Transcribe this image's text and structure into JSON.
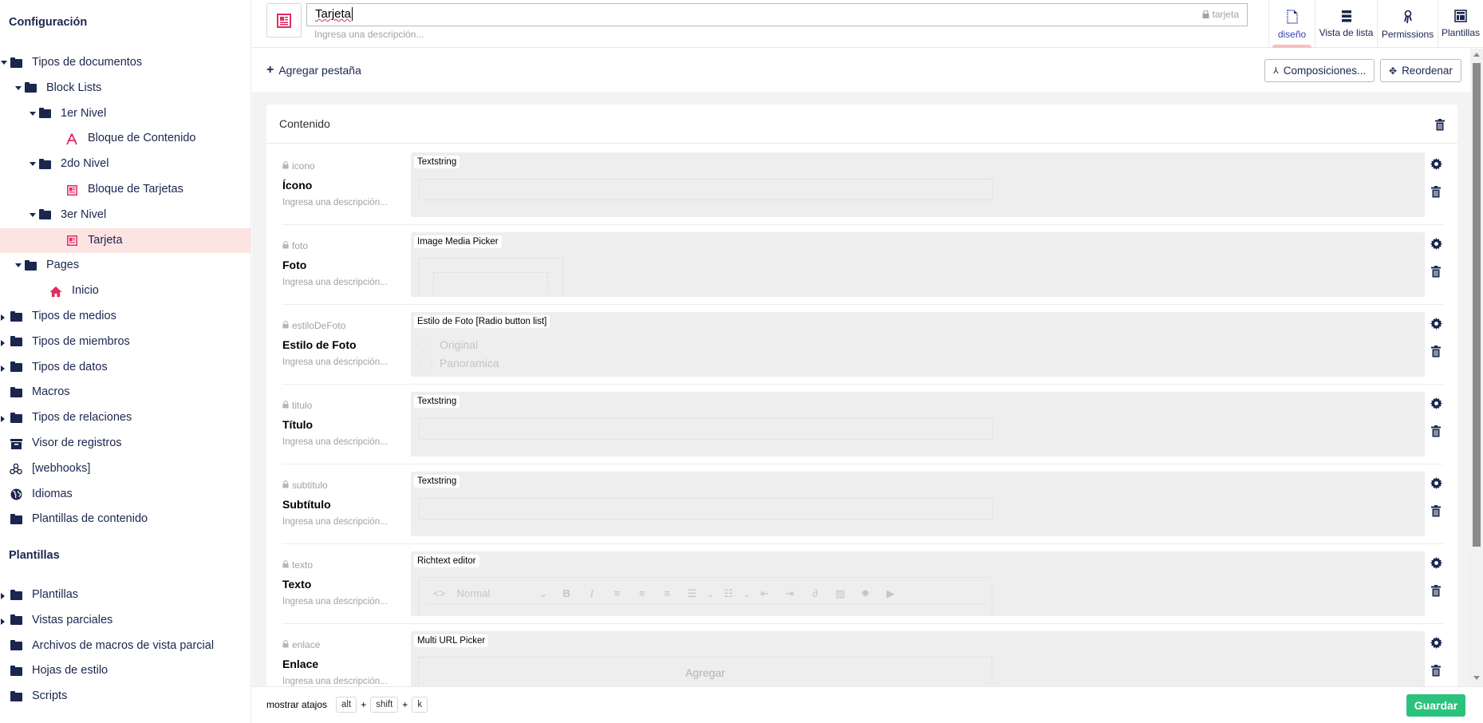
{
  "sidebar": {
    "sections": [
      {
        "title": "Configuración"
      },
      {
        "title": "Plantillas"
      }
    ],
    "items": [
      {
        "label": "Tipos de documentos",
        "icon": "folder-icon",
        "caret": "down"
      },
      {
        "label": "Block Lists",
        "icon": "folder-icon",
        "caret": "down"
      },
      {
        "label": "1er Nivel",
        "icon": "folder-icon",
        "caret": "down"
      },
      {
        "label": "Bloque de Contenido",
        "icon": "compass-icon",
        "caret": "none"
      },
      {
        "label": "2do Nivel",
        "icon": "folder-icon",
        "caret": "down"
      },
      {
        "label": "Bloque de Tarjetas",
        "icon": "newspaper-icon",
        "caret": "none"
      },
      {
        "label": "3er Nivel",
        "icon": "folder-icon",
        "caret": "down"
      },
      {
        "label": "Tarjeta",
        "icon": "newspaper-icon",
        "caret": "none",
        "active": true
      },
      {
        "label": "Pages",
        "icon": "folder-icon",
        "caret": "down"
      },
      {
        "label": "Inicio",
        "icon": "home-icon",
        "caret": "none"
      },
      {
        "label": "Tipos de medios",
        "icon": "folder-icon",
        "caret": "right"
      },
      {
        "label": "Tipos de miembros",
        "icon": "folder-icon",
        "caret": "right"
      },
      {
        "label": "Tipos de datos",
        "icon": "folder-icon",
        "caret": "right"
      },
      {
        "label": "Macros",
        "icon": "folder-icon",
        "caret": "none"
      },
      {
        "label": "Tipos de relaciones",
        "icon": "folder-icon",
        "caret": "right"
      },
      {
        "label": "Visor de registros",
        "icon": "archive-icon",
        "caret": "none"
      },
      {
        "label": "[webhooks]",
        "icon": "webhook-icon",
        "caret": "none"
      },
      {
        "label": "Idiomas",
        "icon": "globe-icon",
        "caret": "none"
      },
      {
        "label": "Plantillas de contenido",
        "icon": "folder-icon",
        "caret": "none"
      }
    ],
    "templates_items": [
      {
        "label": "Plantillas",
        "icon": "folder-icon",
        "caret": "right"
      },
      {
        "label": "Vistas parciales",
        "icon": "folder-icon",
        "caret": "right"
      },
      {
        "label": "Archivos de macros de vista parcial",
        "icon": "folder-icon",
        "caret": "none"
      },
      {
        "label": "Hojas de estilo",
        "icon": "folder-icon",
        "caret": "none"
      },
      {
        "label": "Scripts",
        "icon": "folder-icon",
        "caret": "none"
      }
    ]
  },
  "header": {
    "name_value": "Tarjeta",
    "alias": "tarjeta",
    "description_placeholder": "Ingresa una descripción...",
    "tabs": [
      {
        "label": "diseño",
        "icon": "document-icon",
        "active": true
      },
      {
        "label": "Vista de lista",
        "icon": "list-icon"
      },
      {
        "label": "Permissions",
        "icon": "permissions-icon"
      },
      {
        "label": "Plantillas",
        "icon": "template-icon"
      }
    ]
  },
  "toolbar": {
    "add_tab_label": "Agregar pestaña",
    "compositions_label": "Composiciones...",
    "reorder_label": "Reordenar"
  },
  "group": {
    "title": "Contenido",
    "properties": [
      {
        "alias": "icono",
        "name": "Ícono",
        "description": "Ingresa una descripción...",
        "editor": "Textstring",
        "type": "text"
      },
      {
        "alias": "foto",
        "name": "Foto",
        "description": "Ingresa una descripción...",
        "editor": "Image Media Picker",
        "type": "media"
      },
      {
        "alias": "estiloDeFoto",
        "name": "Estilo de Foto",
        "description": "Ingresa una descripción...",
        "editor": "Estilo de Foto [Radio button list]",
        "type": "radio",
        "options": [
          "Original",
          "Panoramica"
        ]
      },
      {
        "alias": "titulo",
        "name": "Título",
        "description": "Ingresa una descripción...",
        "editor": "Textstring",
        "type": "text"
      },
      {
        "alias": "subtitulo",
        "name": "Subtítulo",
        "description": "Ingresa una descripción...",
        "editor": "Textstring",
        "type": "text"
      },
      {
        "alias": "texto",
        "name": "Texto",
        "description": "Ingresa una descripción...",
        "editor": "Richtext editor",
        "type": "rte",
        "format_value": "Normal"
      },
      {
        "alias": "enlace",
        "name": "Enlace",
        "description": "Ingresa una descripción...",
        "editor": "Multi URL Picker",
        "type": "url",
        "add_label": "Agregar"
      }
    ]
  },
  "footer": {
    "shortcuts_label": "mostrar atajos",
    "keys": [
      "alt",
      "shift",
      "k"
    ],
    "plus": "+",
    "save_label": "Guardar"
  },
  "colors": {
    "accent_pink": "#e22c60",
    "active_bg": "#fde4e3",
    "save_green": "#2bc37c",
    "navy": "#1b264f"
  }
}
